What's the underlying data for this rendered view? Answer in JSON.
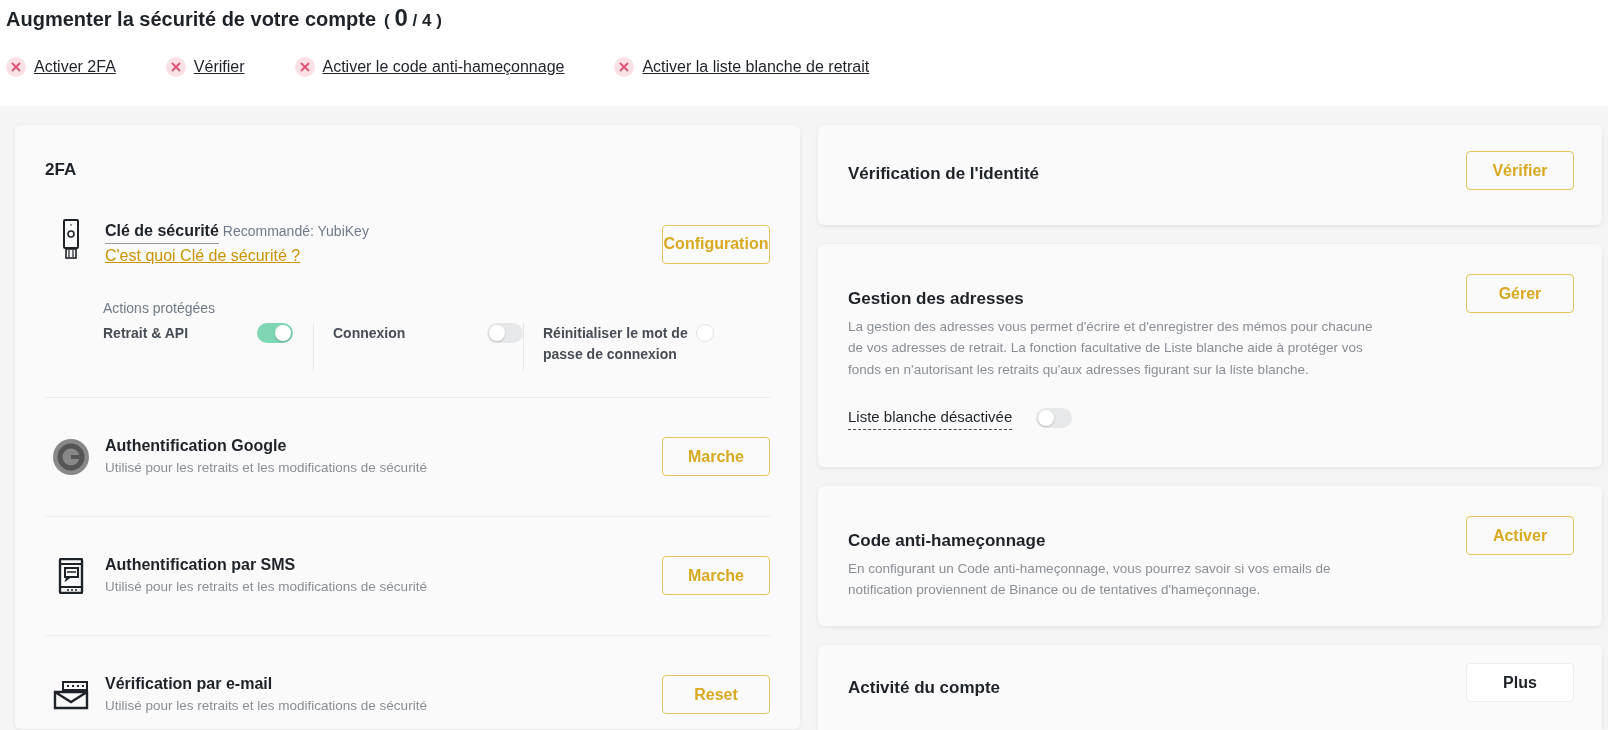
{
  "header": {
    "title": "Augmenter la sécurité de votre compte",
    "progress": {
      "before": "(",
      "done": "0",
      "after": "/ 4 )"
    }
  },
  "tasks": [
    {
      "label": "Activer 2FA",
      "done": false
    },
    {
      "label": "Vérifier",
      "done": false
    },
    {
      "label": "Activer le code anti-hameçonnage",
      "done": false
    },
    {
      "label": "Activer la liste blanche de retrait",
      "done": false
    }
  ],
  "twofa": {
    "title": "2FA",
    "security_key": {
      "title": "Clé de sécurité",
      "hint": "Recommandé: YubiKey",
      "link": "C'est quoi Clé de sécurité ?",
      "button": "Configuration",
      "actions_label": "Actions protégées",
      "actions": [
        {
          "label": "Retrait & API",
          "on": true,
          "disabled": false
        },
        {
          "label": "Connexion",
          "on": false,
          "disabled": false
        },
        {
          "label": "Réinitialiser le mot de passe de connexion",
          "on": false,
          "disabled": true
        }
      ]
    },
    "methods": [
      {
        "kind": "google",
        "title": "Authentification Google",
        "description": "Utilisé pour les retraits et les modifications de sécurité",
        "button": "Marche"
      },
      {
        "kind": "sms",
        "title": "Authentification par SMS",
        "description": "Utilisé pour les retraits et les modifications de sécurité",
        "button": "Marche"
      },
      {
        "kind": "email",
        "title": "Vérification par e-mail",
        "description": "Utilisé pour les retraits et les modifications de sécurité",
        "button": "Reset"
      }
    ]
  },
  "panels": [
    {
      "title": "Vérification de l'identité",
      "button": "Vérifier",
      "kind": "action"
    },
    {
      "title": "Gestion des adresses",
      "description": "La gestion des adresses vous permet d'écrire et d'enregistrer des mémos pour chacune de vos adresses de retrait. La fonction facultative de Liste blanche aide à protéger vos fonds en n'autorisant les retraits qu'aux adresses figurant sur la liste blanche.",
      "button": "Gérer",
      "kind": "action",
      "toggle": {
        "label": "Liste blanche désactivée",
        "on": false
      }
    },
    {
      "title": "Code anti-hameçonnage",
      "description": "En configurant un Code anti-hameçonnage, vous pourrez savoir si vos emails de notification proviennent de Binance ou de tentatives d'hameçonnage.",
      "button": "Activer",
      "kind": "action"
    },
    {
      "title": "Activité du compte",
      "button": "Plus",
      "kind": "more"
    }
  ]
}
